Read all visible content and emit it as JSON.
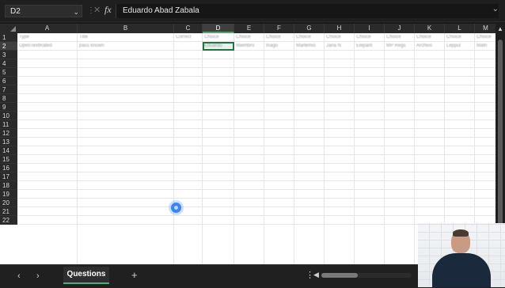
{
  "formula_bar": {
    "name_box": "D2",
    "formula_value": "Eduardo Abad Zabala",
    "fx_label": "fx"
  },
  "columns": [
    "A",
    "B",
    "C",
    "D",
    "E",
    "F",
    "G",
    "H",
    "I",
    "J",
    "K",
    "L",
    "M"
  ],
  "selected_column": "D",
  "rows": [
    "1",
    "2",
    "3",
    "4",
    "5",
    "6",
    "7",
    "8",
    "9",
    "10",
    "11",
    "12",
    "13",
    "14",
    "15",
    "16",
    "17",
    "18",
    "19",
    "20",
    "21",
    "22"
  ],
  "selected_row": "2",
  "cells": {
    "r1": [
      "Type",
      "Title",
      "Correct",
      "Choice",
      "Choice",
      "Choice",
      "Choice",
      "Choice",
      "Choice",
      "Choice",
      "Choice",
      "Choice",
      "Choice"
    ],
    "r2": [
      "OpenTextRated",
      "pass known",
      "",
      "Eduardo",
      "Miembro",
      "Inago",
      "Marlemio",
      "Jana N",
      "Elepant",
      "MP Regs",
      "Archivo",
      "Leppul",
      "Matri"
    ]
  },
  "sheet_tabs": [
    "Questions"
  ],
  "active_sheet": "Questions",
  "colors": {
    "accent": "#217346",
    "tab_underline": "#4caf7a",
    "dark_chrome": "#1f1f1f"
  }
}
